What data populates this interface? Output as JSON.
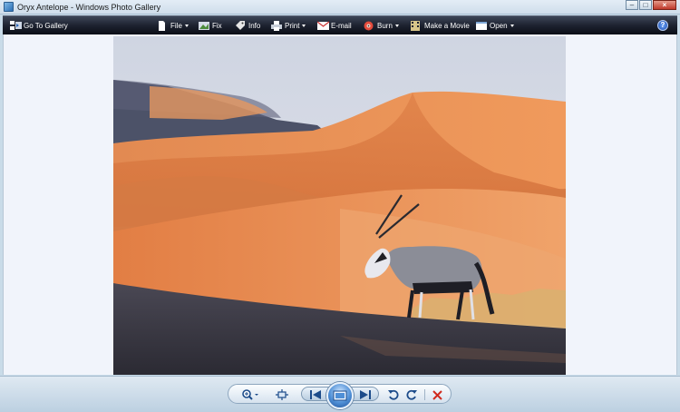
{
  "window": {
    "title": "Oryx Antelope - Windows Photo Gallery",
    "min_icon": "minimize-icon",
    "max_icon": "maximize-icon",
    "close_icon": "close-icon"
  },
  "toolbar": {
    "go_to_gallery": "Go To Gallery",
    "file": "File",
    "fix": "Fix",
    "info": "Info",
    "print": "Print",
    "email": "E-mail",
    "burn": "Burn",
    "make_movie": "Make a Movie",
    "open": "Open",
    "help_icon": "help-icon"
  },
  "photo": {
    "subject": "oryx-antelope-photo"
  },
  "controls": {
    "zoom_icon": "zoom-icon",
    "actual_size_icon": "actual-size-icon",
    "previous_icon": "previous-icon",
    "slideshow_icon": "slideshow-icon",
    "next_icon": "next-icon",
    "rotate_ccw_icon": "rotate-counterclockwise-icon",
    "rotate_cw_icon": "rotate-clockwise-icon",
    "delete_icon": "delete-icon"
  },
  "colors": {
    "toolbar_bg": "#1d2230",
    "viewer_bg": "#f1f4fb",
    "dune_orange": "#e48a4f",
    "sky": "#dfe2ea"
  }
}
